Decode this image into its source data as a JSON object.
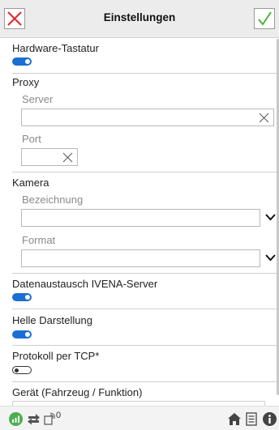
{
  "header": {
    "title": "Einstellungen",
    "cancel_icon": "close-x-icon",
    "confirm_icon": "checkmark-icon",
    "cancel_color": "#e0282e",
    "confirm_color": "#49b337"
  },
  "settings": {
    "hardware_keyboard": {
      "label": "Hardware-Tastatur",
      "enabled": true
    },
    "proxy": {
      "label": "Proxy",
      "server": {
        "label": "Server",
        "value": ""
      },
      "port": {
        "label": "Port",
        "value": ""
      }
    },
    "camera": {
      "label": "Kamera",
      "name": {
        "label": "Bezeichnung",
        "value": ""
      },
      "format": {
        "label": "Format",
        "value": ""
      }
    },
    "data_exchange": {
      "label": "Datenaustausch IVENA-Server",
      "enabled": true
    },
    "light_mode": {
      "label": "Helle Darstellung",
      "enabled": true
    },
    "tcp_log": {
      "label": "Protokoll per TCP*",
      "enabled": false
    },
    "device": {
      "label": "Gerät (Fahrzeug / Funktion)"
    }
  },
  "footer": {
    "signal_icon": "signal-bars-icon",
    "sync_icon": "transfer-arrows-icon",
    "wifi_icon": "wireless-icon",
    "wifi_count": "0",
    "home_icon": "home-icon",
    "document_icon": "document-icon",
    "info_icon": "info-icon",
    "signal_color": "#4caf50"
  },
  "colors": {
    "toggle_on": "#1a6fd4",
    "header_bg": "#ececec"
  }
}
